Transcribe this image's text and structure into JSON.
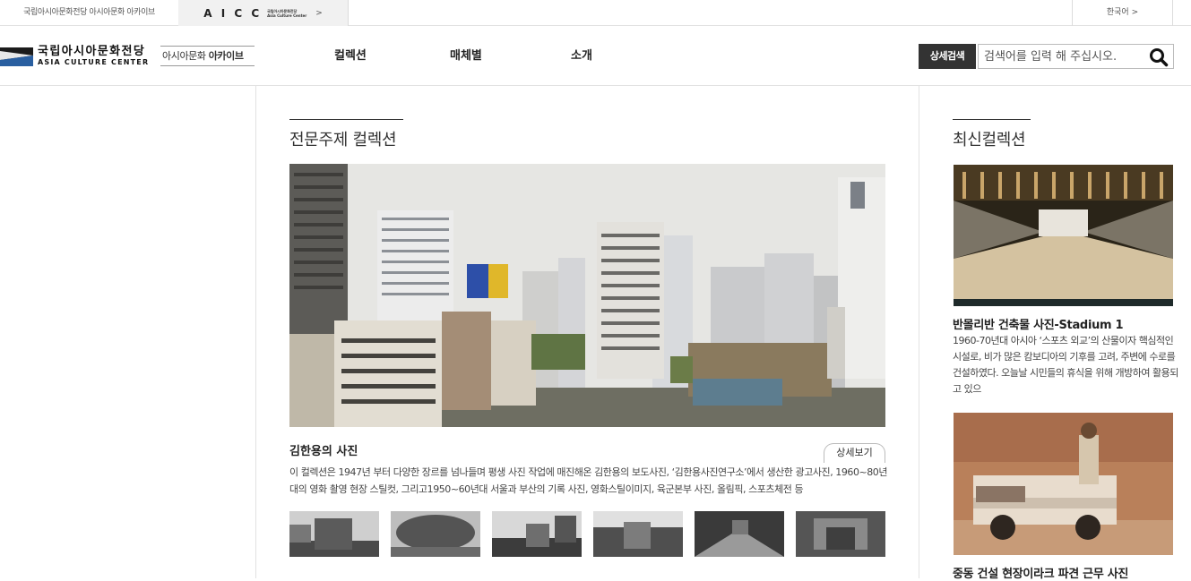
{
  "topbar": {
    "site_link": "국립아시아문화전당 아시아문화 아카이브",
    "acc_letters": "A I C C",
    "acc_small_ko": "국립아시아문화전당",
    "acc_small_en": "Asia Culture Center",
    "acc_chevron": ">",
    "language": "한국어 >"
  },
  "header": {
    "logo_ko": "국립아시아문화전당",
    "logo_en": "ASIA CULTURE CENTER",
    "archive_prefix": "아시아문화 ",
    "archive_bold": "아카이브",
    "nav": [
      "컬렉션",
      "매체별",
      "소개"
    ],
    "detail_search_label": "상세검색",
    "search_placeholder": "검색어를 입력 해 주십시오."
  },
  "main": {
    "section_title": "전문주제 컬렉션",
    "collection_name": "김한용의 사진",
    "more_label": "상세보기",
    "description": "이 컬렉션은 1947년 부터 다양한 장르를 넘나들며 평생 사진 작업에 매진해온 김한용의 보도사진, ‘김한용사진연구소’에서 생산한 광고사진, 1960~80년대의 영화 촬영 현장 스틸컷, 그리고1950~60년대 서울과 부산의 기록 사진, 영화스틸이미지, 육군본부 사진, 올림픽, 스포츠체전 등"
  },
  "side": {
    "section_title": "최신컬렉션",
    "items": [
      {
        "title": "반몰리반 건축물 사진-Stadium 1",
        "description": "1960-70년대 아시아 ‘스포츠 외교’의 산물이자 핵심적인 시설로, 비가 많은 캄보디아의 기후를 고려, 주변에 수로를 건설하였다. 오늘날 시민들의 휴식을 위해 개방하여 활용되고 있으"
      },
      {
        "title": "중동 건설 현장이라크 파견 근무 사진"
      }
    ]
  },
  "colors": {
    "dark_button": "#333333",
    "divider": "#e2e2e2"
  }
}
